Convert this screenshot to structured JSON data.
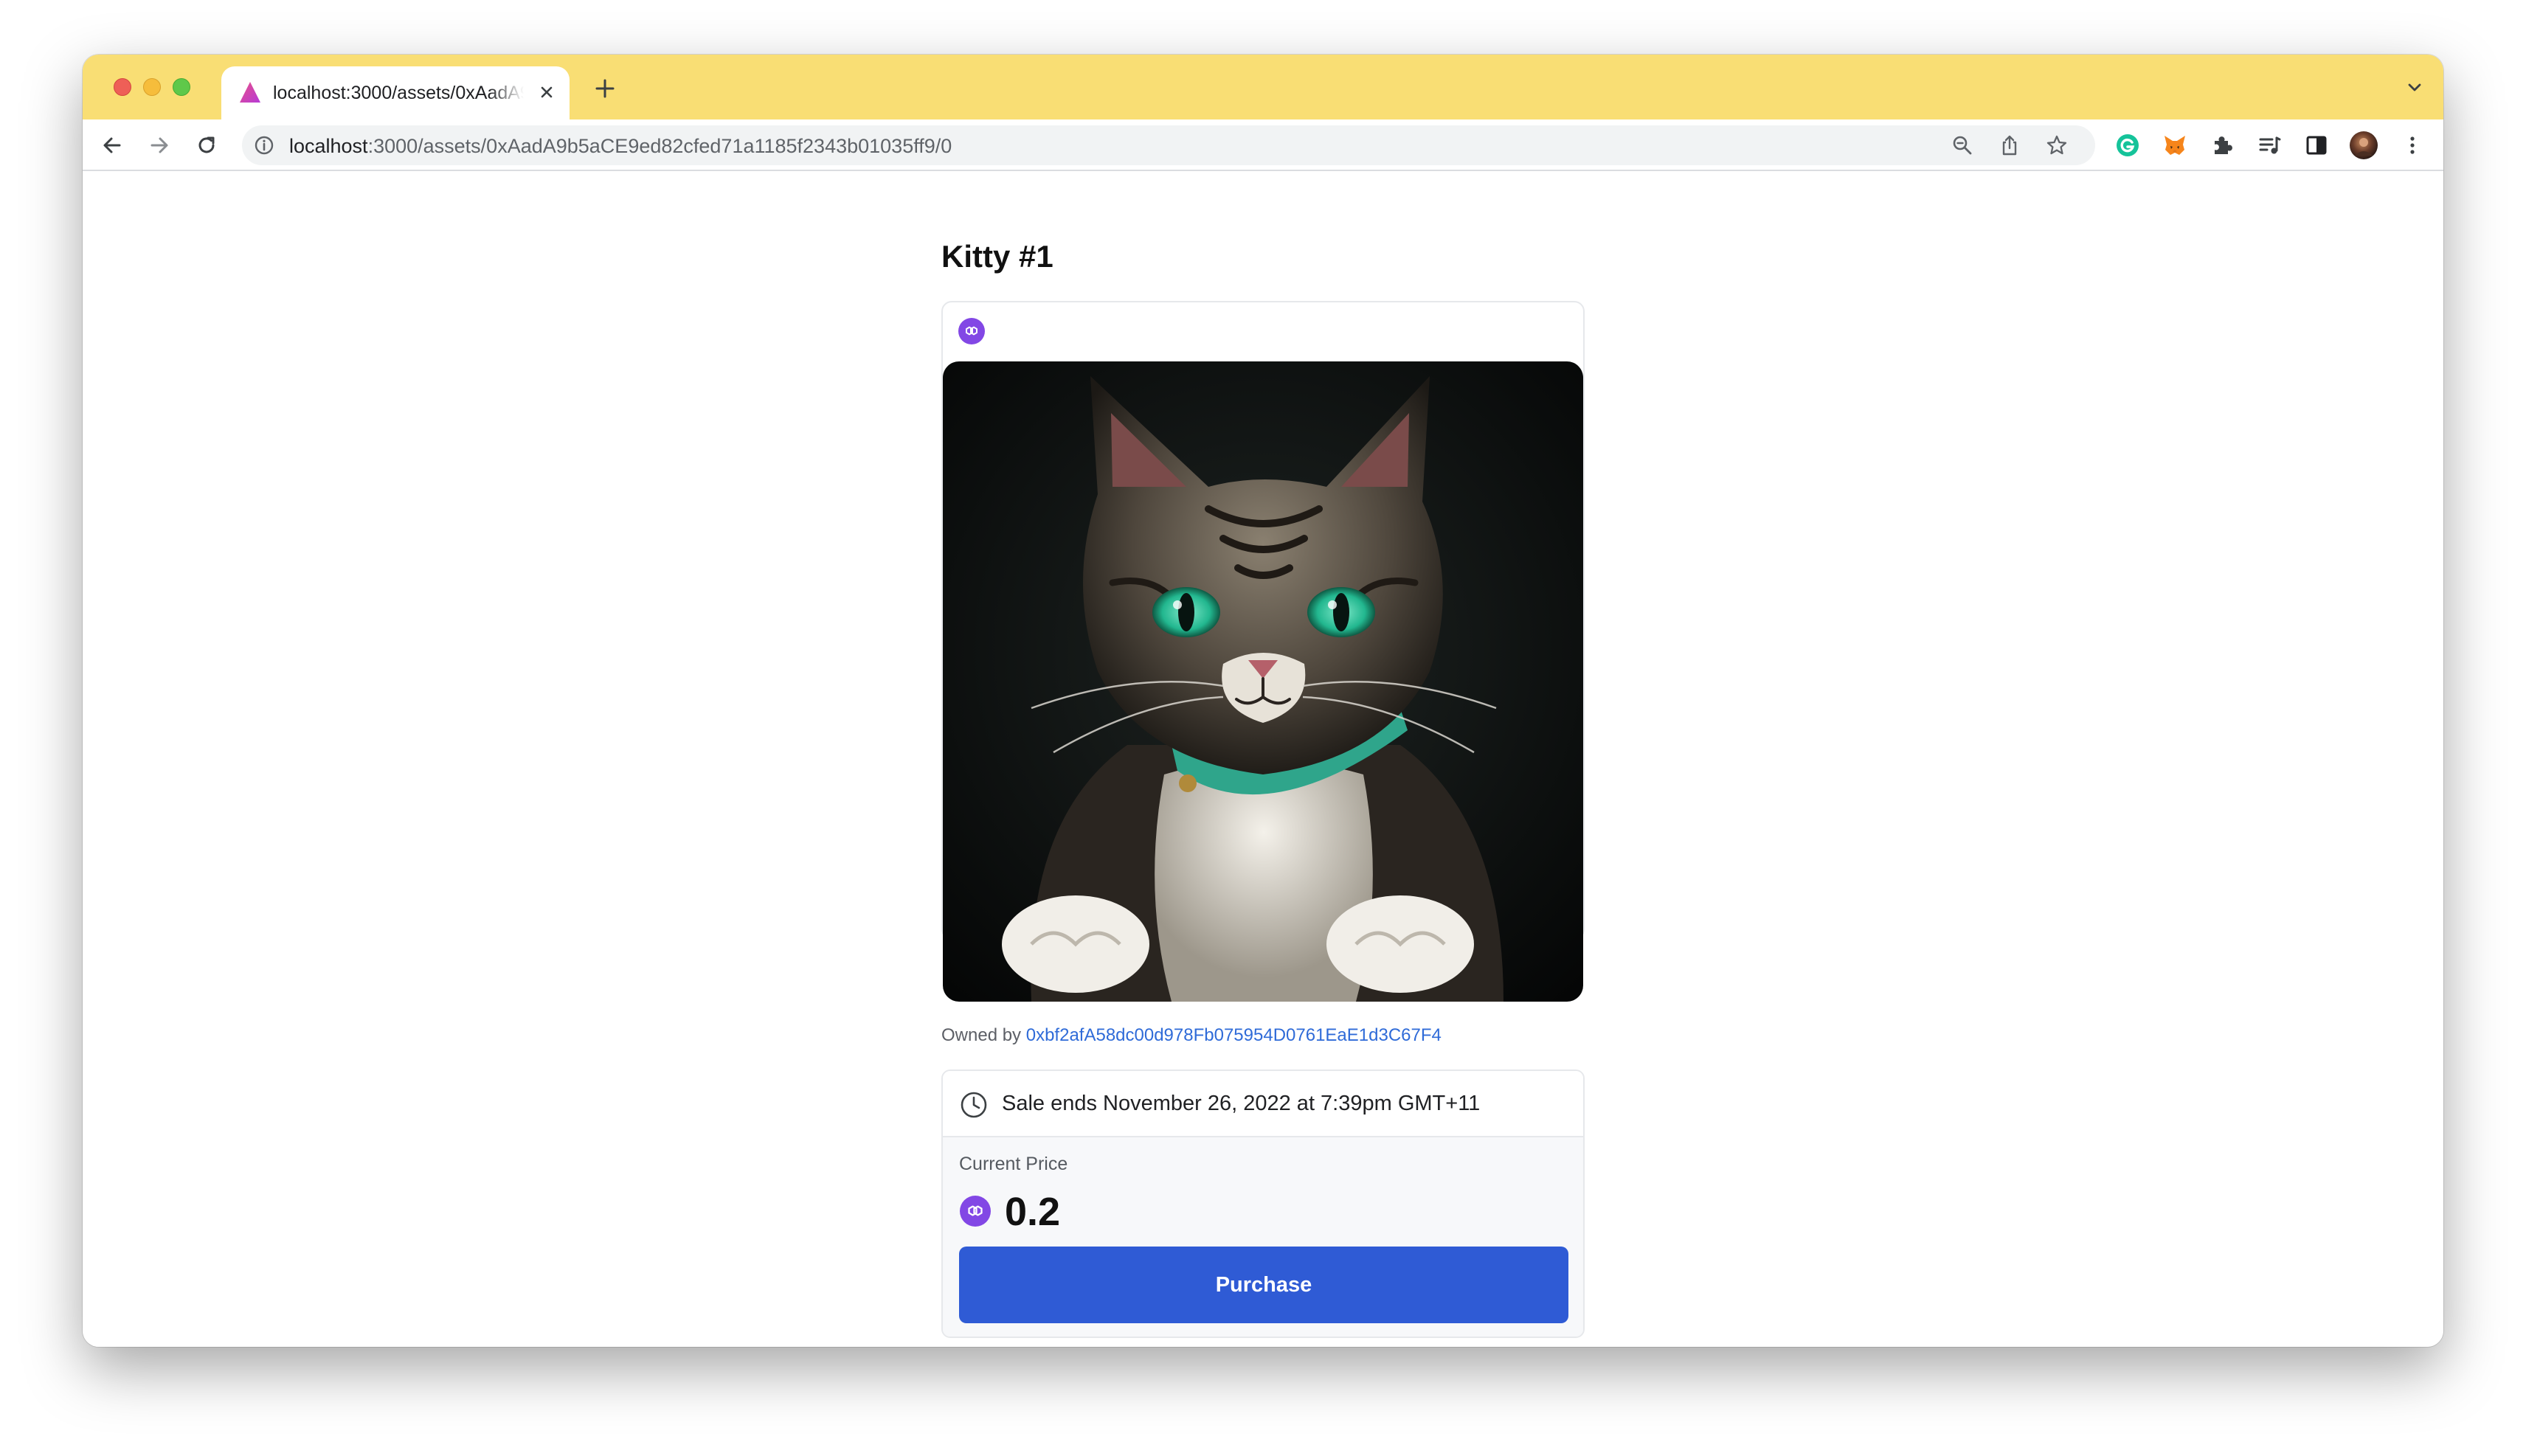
{
  "browser": {
    "tab": {
      "title": "localhost:3000/assets/0xAadA9b5aCE9ed82cfed71a1185f2343b01035ff9/0"
    },
    "address_bar": {
      "host": "localhost",
      "path": ":3000/assets/0xAadA9b5aCE9ed82cfed71a1185f2343b01035ff9/0"
    },
    "icons": {
      "back": "back-arrow-icon",
      "forward": "forward-arrow-icon",
      "reload": "reload-icon",
      "info": "info-icon",
      "zoom": "zoom-icon",
      "share": "share-icon",
      "bookmark": "star-icon",
      "extensions": [
        "grammarly-icon",
        "metamask-fox-icon",
        "puzzle-icon",
        "reading-list-icon",
        "side-panel-icon"
      ],
      "profile": "avatar",
      "menu": "more-vertical-icon"
    },
    "colors": {
      "tab_strip": "#f9de74"
    }
  },
  "asset": {
    "title": "Kitty #1",
    "owner_label": "Owned by",
    "owner_address": "0xbf2afA58dc00d978Fb075954D0761EaE1d3C67F4",
    "chain_icon": "polygon-chain-icon",
    "sale_ends": "Sale ends November 26, 2022 at 7:39pm GMT+11",
    "price_label": "Current Price",
    "price_value": "0.2",
    "purchase_label": "Purchase",
    "colors": {
      "accent": "#2f5bd5",
      "chain": "#8247e5",
      "link": "#2f6bd8"
    }
  }
}
